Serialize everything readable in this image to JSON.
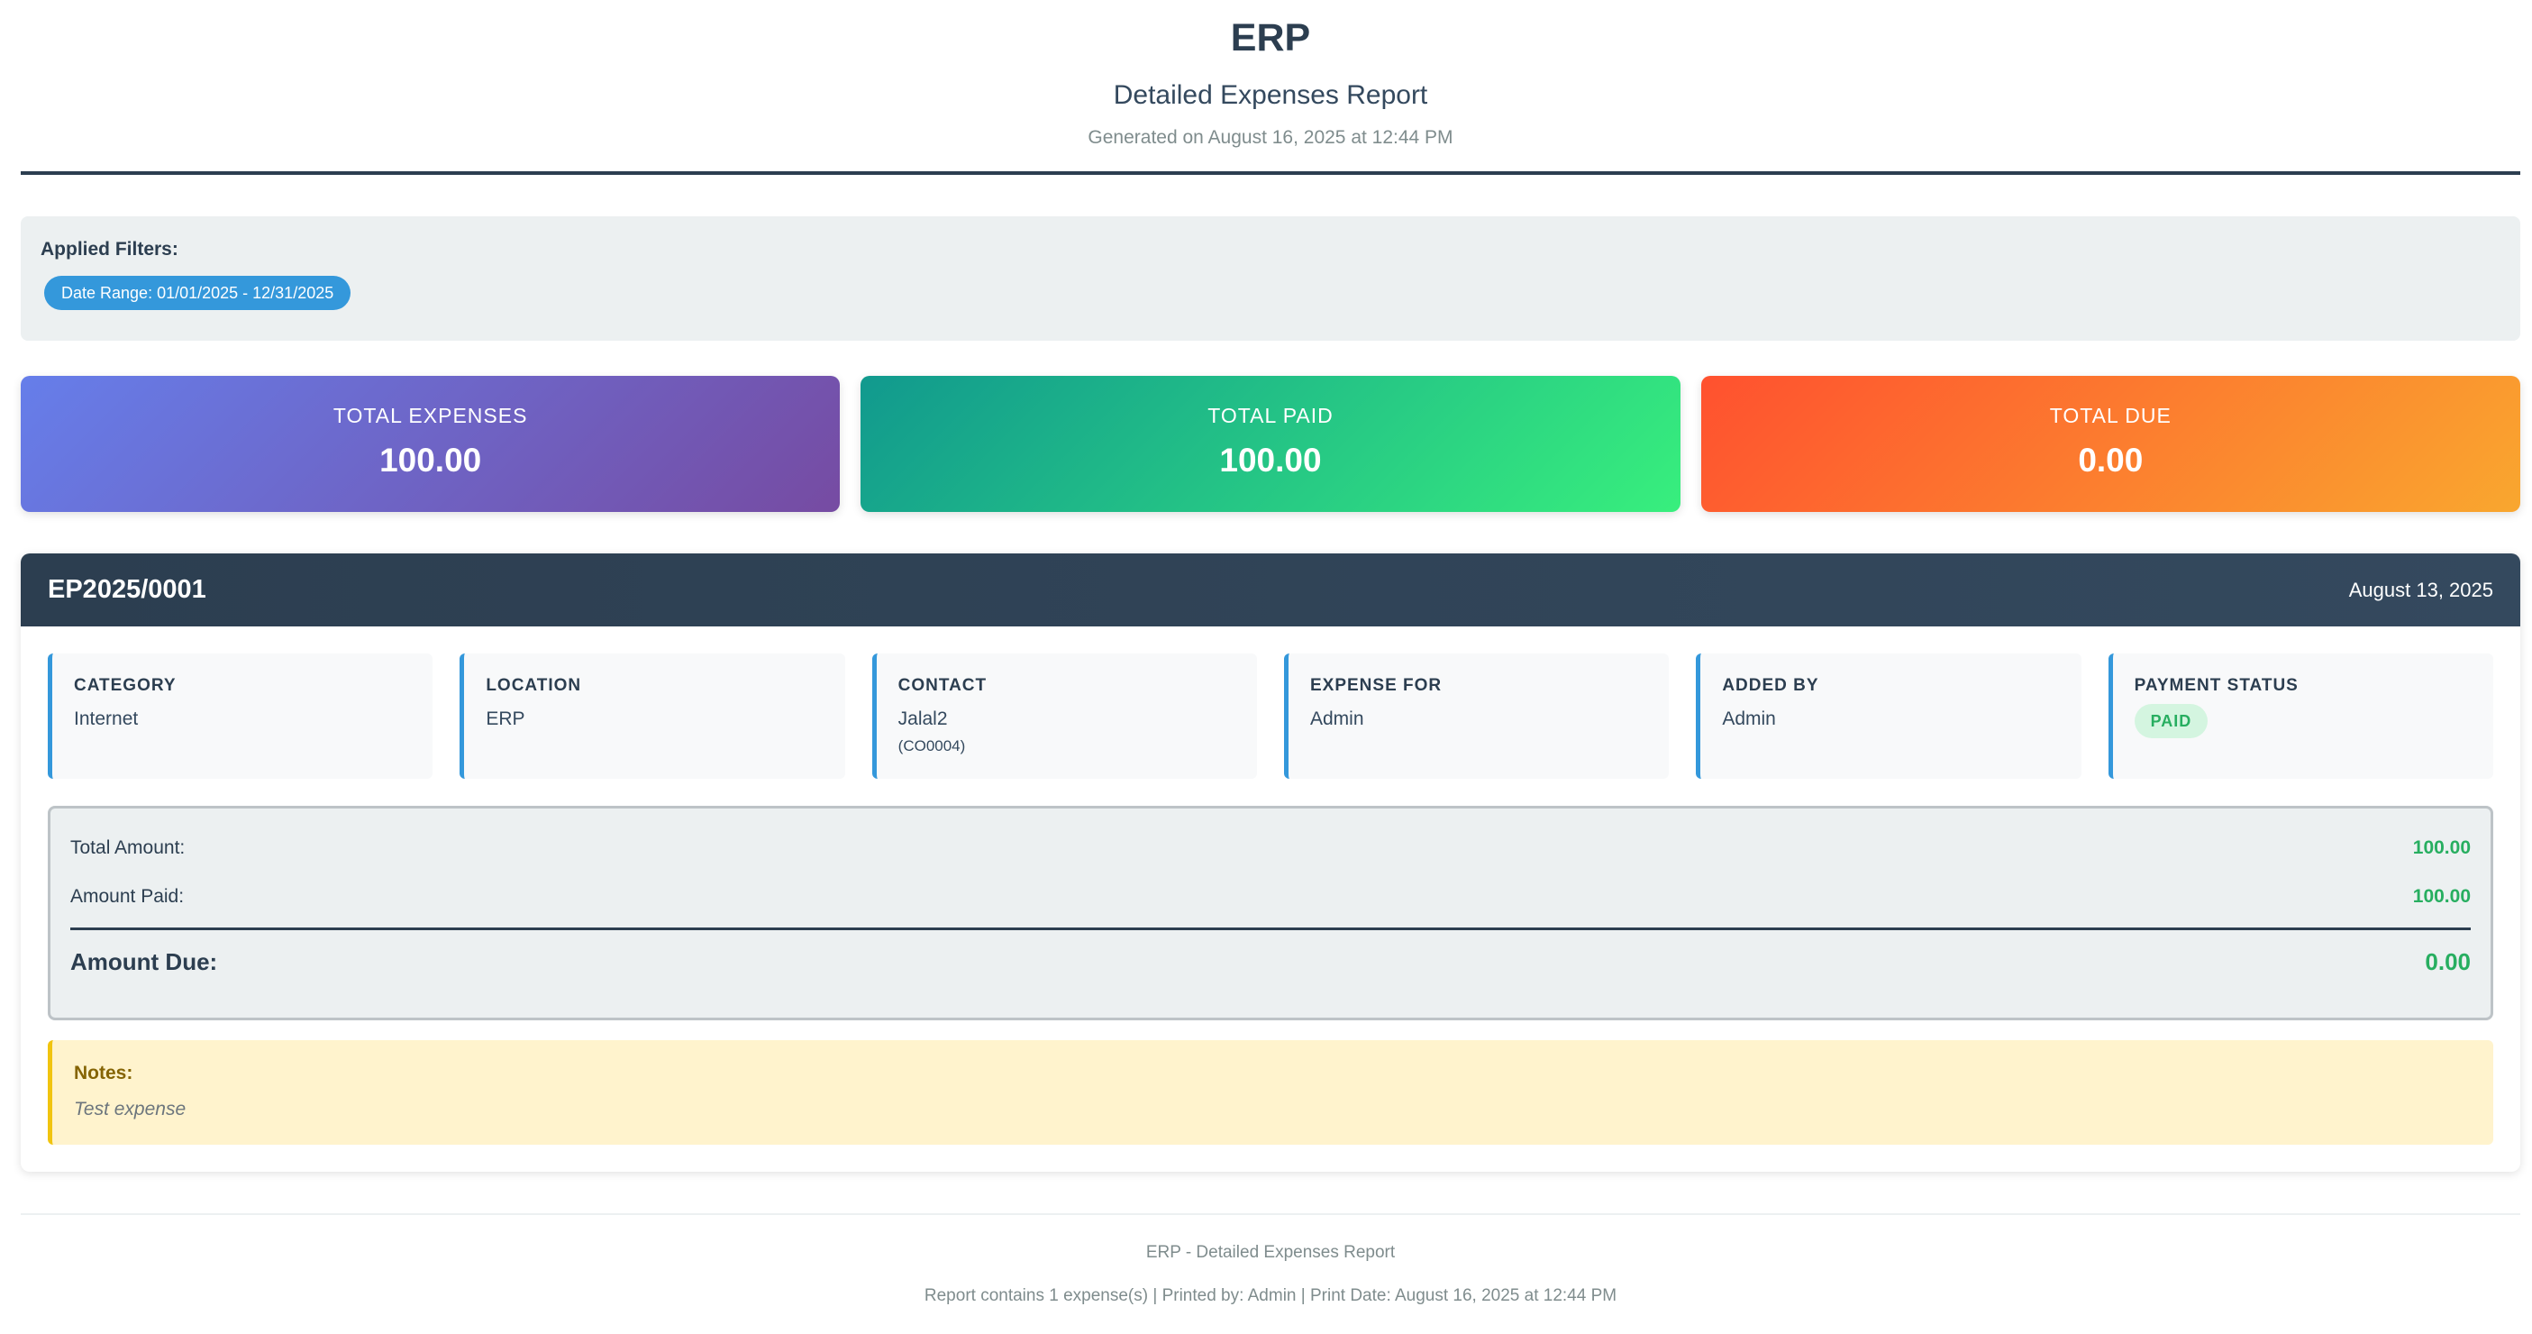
{
  "header": {
    "app_name": "ERP",
    "report_title": "Detailed Expenses Report",
    "generated": "Generated on August 16, 2025 at 12:44 PM"
  },
  "filters": {
    "label": "Applied Filters:",
    "chips": [
      "Date Range: 01/01/2025 - 12/31/2025"
    ]
  },
  "summary": [
    {
      "label": "TOTAL EXPENSES",
      "value": "100.00",
      "color_from": "#667eea",
      "color_to": "#764ba2"
    },
    {
      "label": "TOTAL PAID",
      "value": "100.00",
      "color_from": "#11998e",
      "color_to": "#38ef7d"
    },
    {
      "label": "TOTAL DUE",
      "value": "0.00",
      "color_from": "#ff512f",
      "color_to": "#f9a72f"
    }
  ],
  "expense": {
    "reference": "EP2025/0001",
    "date": "August 13, 2025",
    "fields": {
      "category": {
        "label": "CATEGORY",
        "value": "Internet"
      },
      "location": {
        "label": "LOCATION",
        "value": "ERP"
      },
      "contact": {
        "label": "CONTACT",
        "value": "Jalal2",
        "sub": "(CO0004)"
      },
      "expense_for": {
        "label": "EXPENSE FOR",
        "value": "Admin"
      },
      "added_by": {
        "label": "ADDED BY",
        "value": "Admin"
      },
      "payment_status": {
        "label": "PAYMENT STATUS",
        "value": "PAID"
      }
    },
    "totals": {
      "total_amount_label": "Total Amount:",
      "total_amount": "100.00",
      "amount_paid_label": "Amount Paid:",
      "amount_paid": "100.00",
      "amount_due_label": "Amount Due:",
      "amount_due": "0.00"
    },
    "notes": {
      "label": "Notes:",
      "text": "Test expense"
    }
  },
  "footer": {
    "line1": "ERP - Detailed Expenses Report",
    "line2": "Report contains 1 expense(s) | Printed by: Admin | Print Date: August 16, 2025 at 12:44 PM"
  }
}
